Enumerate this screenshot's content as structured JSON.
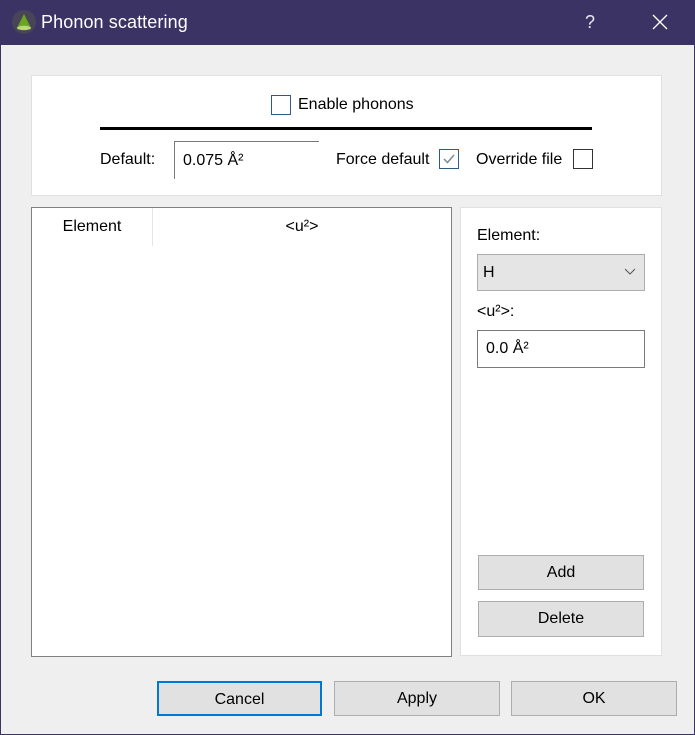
{
  "window": {
    "title": "Phonon scattering",
    "help_label": "?",
    "icons": {
      "app": "green-cone-icon",
      "close": "close-icon"
    }
  },
  "top_group": {
    "enable_phonons_label": "Enable phonons",
    "enable_phonons_checked": false,
    "default_label": "Default:",
    "default_value": "0.075 Å²",
    "force_default_label": "Force default",
    "force_default_checked": true,
    "override_file_label": "Override file",
    "override_file_checked": false
  },
  "table": {
    "columns": [
      "Element",
      "<u²>"
    ],
    "rows": []
  },
  "side_panel": {
    "element_label": "Element:",
    "element_selected": "H",
    "u2_label": "<u²>:",
    "u2_value": "0.0 Å²",
    "add_label": "Add",
    "delete_label": "Delete"
  },
  "footer": {
    "cancel_label": "Cancel",
    "apply_label": "Apply",
    "ok_label": "OK"
  },
  "colors": {
    "titlebar": "#3b3363",
    "focus_accent": "#0078d7",
    "icon_green": "#6aa51e"
  }
}
